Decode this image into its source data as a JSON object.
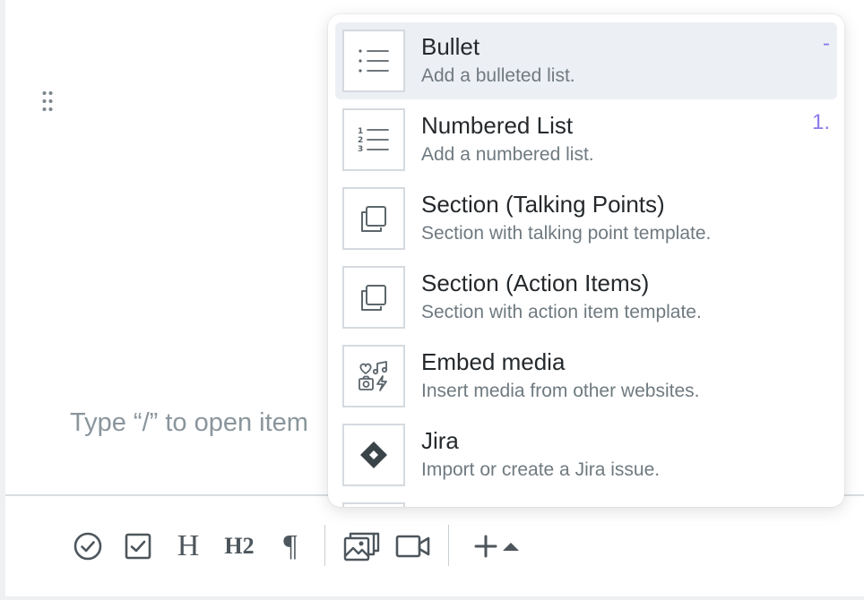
{
  "editor": {
    "placeholder": "Type “/” to open item"
  },
  "menu": {
    "items": [
      {
        "title": "Bullet",
        "description": "Add a bulleted list.",
        "shortcut": "-",
        "icon": "bulleted-list-icon",
        "active": true
      },
      {
        "title": "Numbered List",
        "description": "Add a numbered list.",
        "shortcut": "1.",
        "icon": "numbered-list-icon",
        "active": false
      },
      {
        "title": "Section (Talking Points)",
        "description": "Section with talking point template.",
        "shortcut": "",
        "icon": "copy-section-icon",
        "active": false
      },
      {
        "title": "Section (Action Items)",
        "description": "Section with action item template.",
        "shortcut": "",
        "icon": "copy-section-icon",
        "active": false
      },
      {
        "title": "Embed media",
        "description": "Insert media from other websites.",
        "shortcut": "",
        "icon": "embed-media-icon",
        "active": false
      },
      {
        "title": "Jira",
        "description": "Import or create a Jira issue.",
        "shortcut": "",
        "icon": "jira-icon",
        "active": false
      }
    ]
  },
  "toolbar": {
    "heading1_label": "H",
    "heading2_label": "H2",
    "paragraph_label": "¶",
    "icons": [
      "check-circle-icon",
      "checkbox-icon",
      "heading-icon",
      "heading-2-icon",
      "paragraph-icon",
      "image-gallery-icon",
      "video-icon",
      "plus-icon",
      "caret-up-icon"
    ]
  },
  "colors": {
    "accent": "#8b7bea",
    "active_item_bg": "#eceff4",
    "icon_stroke": "#5c666c",
    "toolbar_icon": "#4d565c"
  }
}
